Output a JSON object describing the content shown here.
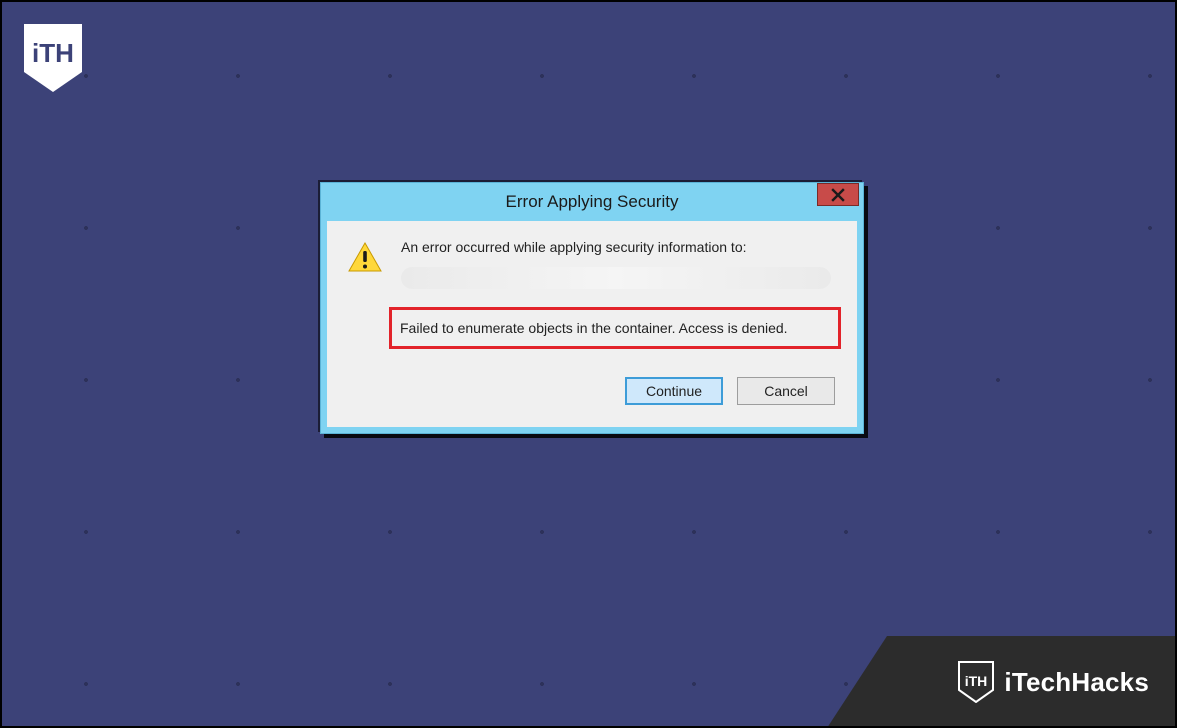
{
  "dialog": {
    "title": "Error Applying Security",
    "message": "An error occurred while applying security information to:",
    "error": "Failed to enumerate objects in the container. Access is denied.",
    "buttons": {
      "continue": "Continue",
      "cancel": "Cancel"
    }
  },
  "brand": {
    "name": "iTechHacks"
  }
}
